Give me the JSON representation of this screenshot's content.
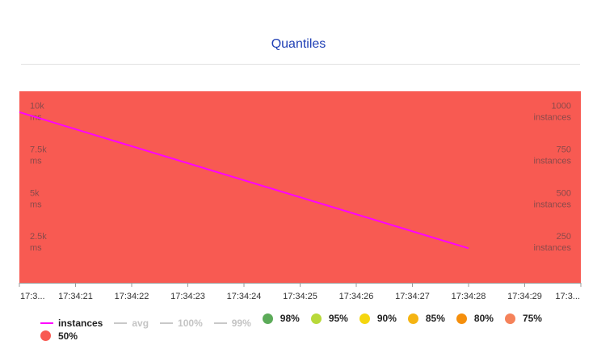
{
  "title": "Quantiles",
  "chart_data": {
    "type": "area",
    "left_axis": {
      "ticks": [
        {
          "value": 10000,
          "label": "10k",
          "unit": "ms"
        },
        {
          "value": 7500,
          "label": "7.5k",
          "unit": "ms"
        },
        {
          "value": 5000,
          "label": "5k",
          "unit": "ms"
        },
        {
          "value": 2500,
          "label": "2.5k",
          "unit": "ms"
        }
      ]
    },
    "right_axis": {
      "ylim": [
        0,
        1100
      ],
      "ticks": [
        {
          "value": 1000,
          "label": "1000",
          "unit": "instances"
        },
        {
          "value": 750,
          "label": "750",
          "unit": "instances"
        },
        {
          "value": 500,
          "label": "500",
          "unit": "instances"
        },
        {
          "value": 250,
          "label": "250",
          "unit": "instances"
        }
      ]
    },
    "x_ticks": [
      "17:3...",
      "17:34:21",
      "17:34:22",
      "17:34:23",
      "17:34:24",
      "17:34:25",
      "17:34:26",
      "17:34:27",
      "17:34:28",
      "17:34:29",
      "17:3..."
    ],
    "x_range": [
      "17:34:20",
      "17:34:30"
    ],
    "instances_line": {
      "name": "instances",
      "color": "#ff00ff",
      "points": [
        {
          "x": "17:34:20",
          "y": 980
        },
        {
          "x": "17:34:28",
          "y": 198
        }
      ]
    },
    "fill_series": {
      "name": "50%",
      "color": "#f85a52"
    },
    "legend": [
      {
        "label": "instances",
        "marker": "line",
        "color": "#ff00ff",
        "enabled": true
      },
      {
        "label": "avg",
        "marker": "line",
        "color": "#c9c9c9",
        "enabled": false
      },
      {
        "label": "100%",
        "marker": "line",
        "color": "#c9c9c9",
        "enabled": false
      },
      {
        "label": "99%",
        "marker": "line",
        "color": "#c9c9c9",
        "enabled": false
      },
      {
        "label": "98%",
        "marker": "dot",
        "color": "#5cab59",
        "enabled": true
      },
      {
        "label": "95%",
        "marker": "dot",
        "color": "#b8d93a",
        "enabled": true
      },
      {
        "label": "90%",
        "marker": "dot",
        "color": "#f5d60f",
        "enabled": true
      },
      {
        "label": "85%",
        "marker": "dot",
        "color": "#f5b412",
        "enabled": true
      },
      {
        "label": "80%",
        "marker": "dot",
        "color": "#f58f0c",
        "enabled": true
      },
      {
        "label": "75%",
        "marker": "dot",
        "color": "#f5825a",
        "enabled": true
      },
      {
        "label": "50%",
        "marker": "dot",
        "color": "#f85a52",
        "enabled": true
      }
    ]
  }
}
